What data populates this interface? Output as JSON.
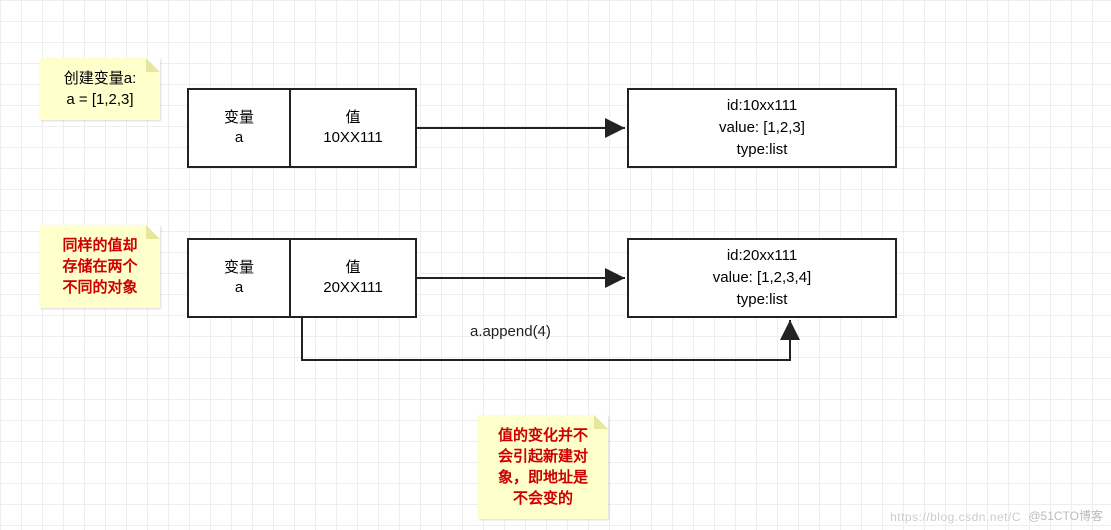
{
  "note1": {
    "line1": "创建变量a:",
    "line2": "a = [1,2,3]"
  },
  "note2": {
    "line1": "同样的值却",
    "line2": "存储在两个",
    "line3": "不同的对象"
  },
  "note3": {
    "line1": "值的变化并不",
    "line2": "会引起新建对",
    "line3": "象，即地址是",
    "line4": "不会变的"
  },
  "row1": {
    "var_label": "变量",
    "var_name": "a",
    "val_label": "值",
    "val_value": "10XX111",
    "obj_id": "id:10xx111",
    "obj_value": "value: [1,2,3]",
    "obj_type": "type:list"
  },
  "row2": {
    "var_label": "变量",
    "var_name": "a",
    "val_label": "值",
    "val_value": "20XX111",
    "obj_id": "id:20xx111",
    "obj_value": "value: [1,2,3,4]",
    "obj_type": "type:list"
  },
  "append_label": "a.append(4)",
  "watermark1": "https://blog.csdn.net/C",
  "watermark2": "@51CTO博客"
}
